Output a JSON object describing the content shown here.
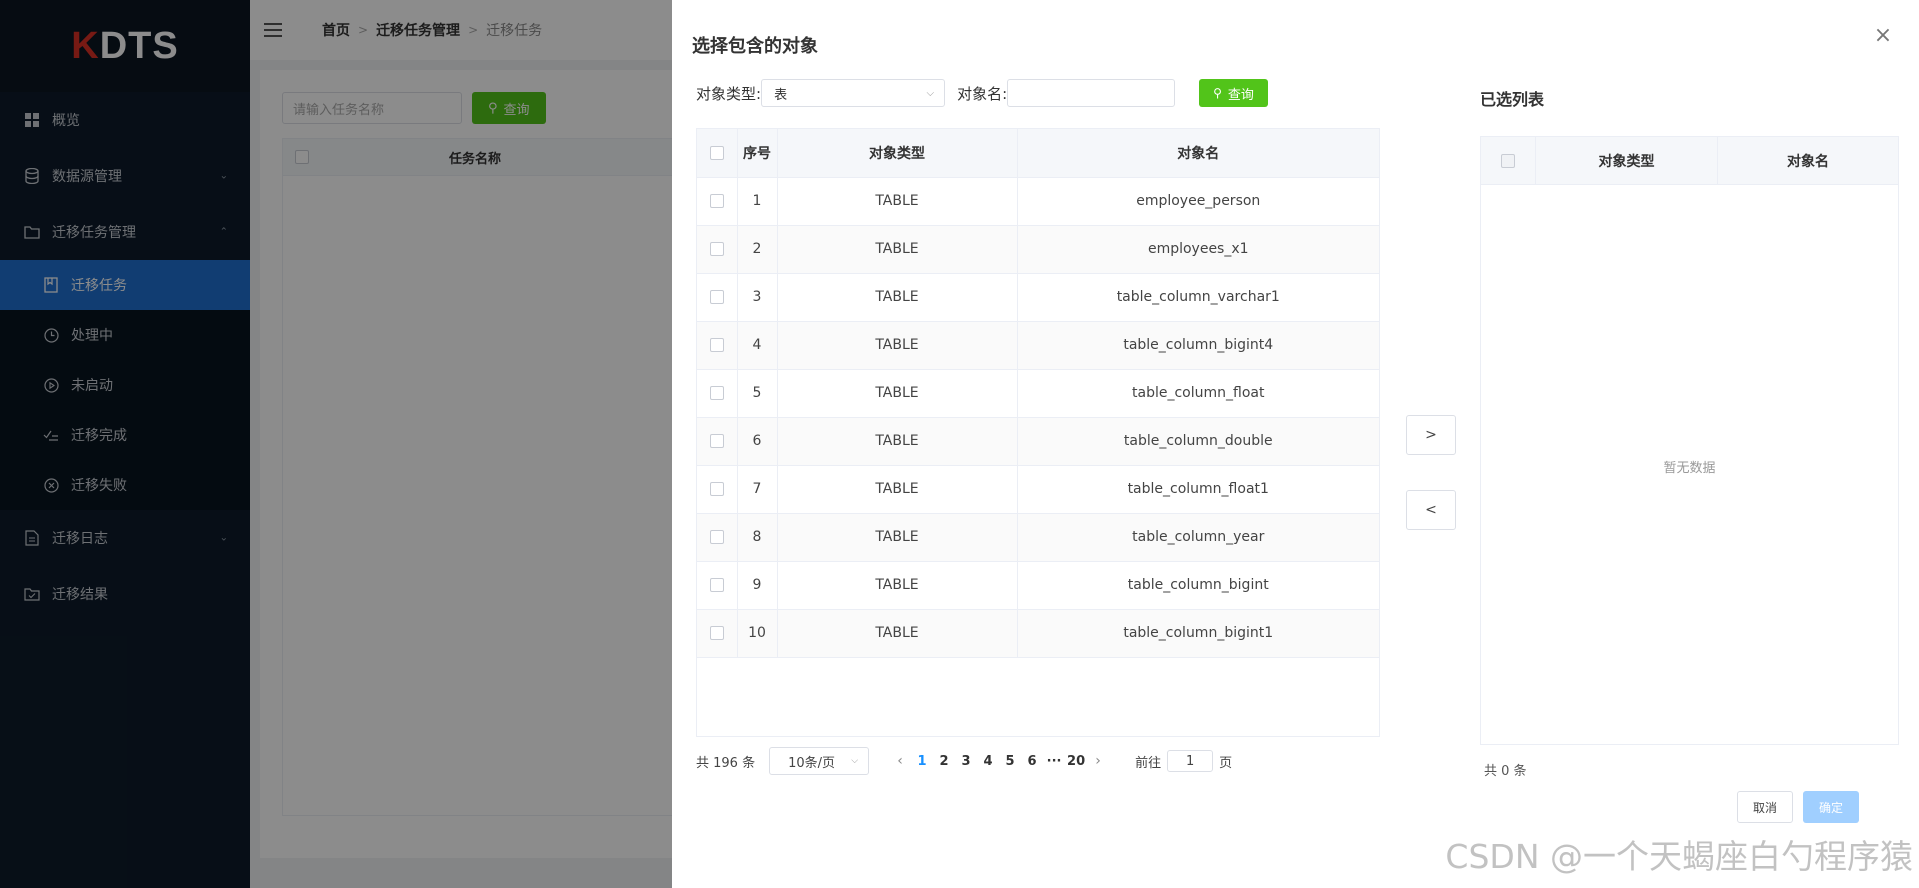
{
  "sidebar": {
    "logo_k": "K",
    "logo_rest": "DTS",
    "items": [
      {
        "label": "概览",
        "icon": "grid-icon"
      },
      {
        "label": "数据源管理",
        "icon": "database-icon"
      },
      {
        "label": "迁移任务管理",
        "icon": "folder-icon"
      },
      {
        "label": "迁移日志",
        "icon": "document-icon"
      },
      {
        "label": "迁移结果",
        "icon": "folder-check-icon"
      }
    ],
    "subitems": [
      {
        "label": "迁移任务",
        "icon": "book-icon"
      },
      {
        "label": "处理中",
        "icon": "clock-icon"
      },
      {
        "label": "未启动",
        "icon": "play-circle-icon"
      },
      {
        "label": "迁移完成",
        "icon": "check-list-icon"
      },
      {
        "label": "迁移失败",
        "icon": "x-circle-icon"
      }
    ]
  },
  "header": {
    "breadcrumb": [
      "首页",
      "迁移任务管理",
      "迁移任务"
    ]
  },
  "background_page": {
    "task_name_placeholder": "请输入任务名称",
    "query_label": "查询",
    "col_task_name": "任务名称"
  },
  "drawer": {
    "title": "选择包含的对象",
    "close_symbol": "×",
    "filter": {
      "type_label": "对象类型:",
      "type_value": "表",
      "name_label": "对象名:",
      "query_label": "查询"
    },
    "table": {
      "headers": [
        "序号",
        "对象类型",
        "对象名"
      ],
      "rows": [
        {
          "no": "1",
          "type": "TABLE",
          "name": "employee_person"
        },
        {
          "no": "2",
          "type": "TABLE",
          "name": "employees_x1"
        },
        {
          "no": "3",
          "type": "TABLE",
          "name": "table_column_varchar1"
        },
        {
          "no": "4",
          "type": "TABLE",
          "name": "table_column_bigint4"
        },
        {
          "no": "5",
          "type": "TABLE",
          "name": "table_column_float"
        },
        {
          "no": "6",
          "type": "TABLE",
          "name": "table_column_double"
        },
        {
          "no": "7",
          "type": "TABLE",
          "name": "table_column_float1"
        },
        {
          "no": "8",
          "type": "TABLE",
          "name": "table_column_year"
        },
        {
          "no": "9",
          "type": "TABLE",
          "name": "table_column_bigint"
        },
        {
          "no": "10",
          "type": "TABLE",
          "name": "table_column_bigint1"
        }
      ]
    },
    "pager": {
      "total": "共 196 条",
      "page_size": "10条/页",
      "prev": "‹",
      "pages": [
        "1",
        "2",
        "3",
        "4",
        "5",
        "6",
        "···",
        "20"
      ],
      "next": "›",
      "goto_prefix": "前往",
      "goto_value": "1",
      "goto_suffix": "页"
    },
    "move_right": ">",
    "move_left": "<",
    "selected": {
      "title": "已选列表",
      "headers": [
        "对象类型",
        "对象名"
      ],
      "empty": "暂无数据",
      "total": "共 0 条"
    },
    "cancel_label": "取消",
    "ok_label": "确定"
  },
  "watermark": "CSDN @一个天蝎座白勺程序猿"
}
